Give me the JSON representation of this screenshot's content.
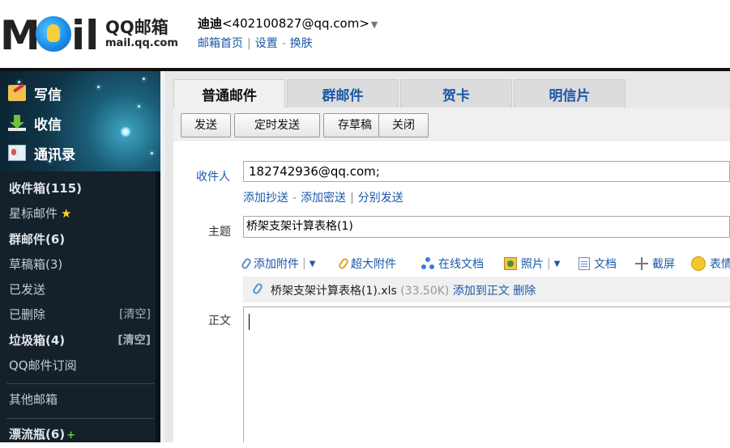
{
  "header": {
    "logo": {
      "mark": "Mail",
      "cn": "QQ邮箱",
      "en": "mail.qq.com"
    },
    "user": {
      "name": "迪迪",
      "email": "<402100827@qq.com>",
      "caret": "▼"
    },
    "links": [
      "邮箱首页",
      "设置",
      "换肤"
    ],
    "link_separators": [
      "|",
      "-"
    ]
  },
  "sidebar": {
    "quick": [
      {
        "label": "写信",
        "icon": "compose-icon"
      },
      {
        "label": "收信",
        "icon": "inbox-download-icon"
      },
      {
        "label": "通讯录",
        "icon": "contacts-icon"
      }
    ],
    "folders": [
      {
        "label": "收件箱(115)",
        "bold": true
      },
      {
        "label": "星标邮件",
        "extra": "★"
      },
      {
        "label": "群邮件(6)",
        "bold": true
      },
      {
        "label": "草稿箱(3)"
      },
      {
        "label": "已发送"
      },
      {
        "label": "已删除",
        "action": "[清空]"
      },
      {
        "label": "垃圾箱(4)",
        "bold": true,
        "action": "[清空]"
      },
      {
        "label": "QQ邮件订阅"
      },
      {
        "label": "其他邮箱"
      },
      {
        "label": "漂流瓶(6)",
        "bold": true,
        "extra": "+"
      }
    ]
  },
  "tabs": [
    "普通邮件",
    "群邮件",
    "贺卡",
    "明信片"
  ],
  "toolbar": {
    "send": "发送",
    "schedule": "定时发送",
    "save_draft": "存草稿",
    "close": "关闭"
  },
  "compose": {
    "to_label": "收件人",
    "to_value": "182742936@qq.com;",
    "recipient_links": [
      "添加抄送",
      "添加密送",
      "分别发送"
    ],
    "recipient_separators": [
      "-",
      "|"
    ],
    "subject_label": "主题",
    "subject_value": "桥架支架计算表格(1)",
    "attach_tools": [
      "添加附件",
      "超大附件",
      "在线文档",
      "照片",
      "文档",
      "截屏",
      "表情"
    ],
    "attachment": {
      "name": "桥架支架计算表格(1).xls",
      "size": "(33.50K)",
      "add_to_body": "添加到正文",
      "delete": "删除"
    },
    "body_label": "正文",
    "body_value": ""
  },
  "colors": {
    "link": "#1a58a8",
    "sidebar": "#14202a",
    "accent_star": "#ffd21c"
  }
}
